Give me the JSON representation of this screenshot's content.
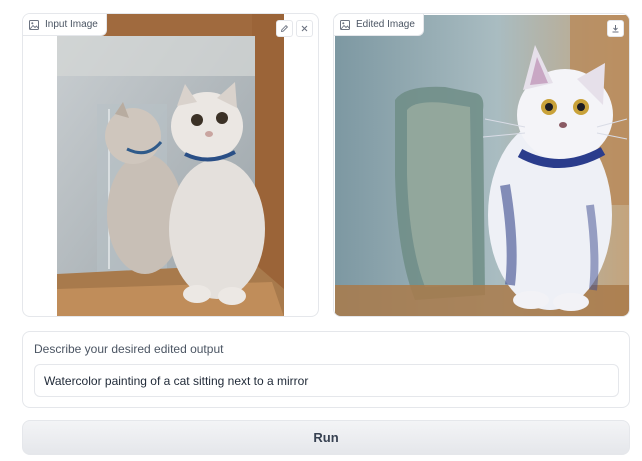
{
  "input_panel": {
    "label": "Input Image",
    "icon": "image-icon",
    "buttons": [
      {
        "name": "edit-button",
        "icon": "pencil-icon"
      },
      {
        "name": "clear-button",
        "icon": "close-icon"
      }
    ]
  },
  "output_panel": {
    "label": "Edited Image",
    "icon": "image-icon",
    "buttons": [
      {
        "name": "download-button",
        "icon": "download-icon"
      }
    ]
  },
  "prompt": {
    "label": "Describe your desired edited output",
    "value": "Watercolor painting of a cat sitting next to a mirror"
  },
  "run_button": {
    "label": "Run"
  },
  "colors": {
    "border": "#e5e7eb",
    "button_bg": "#e5e7eb",
    "text": "#374151"
  }
}
